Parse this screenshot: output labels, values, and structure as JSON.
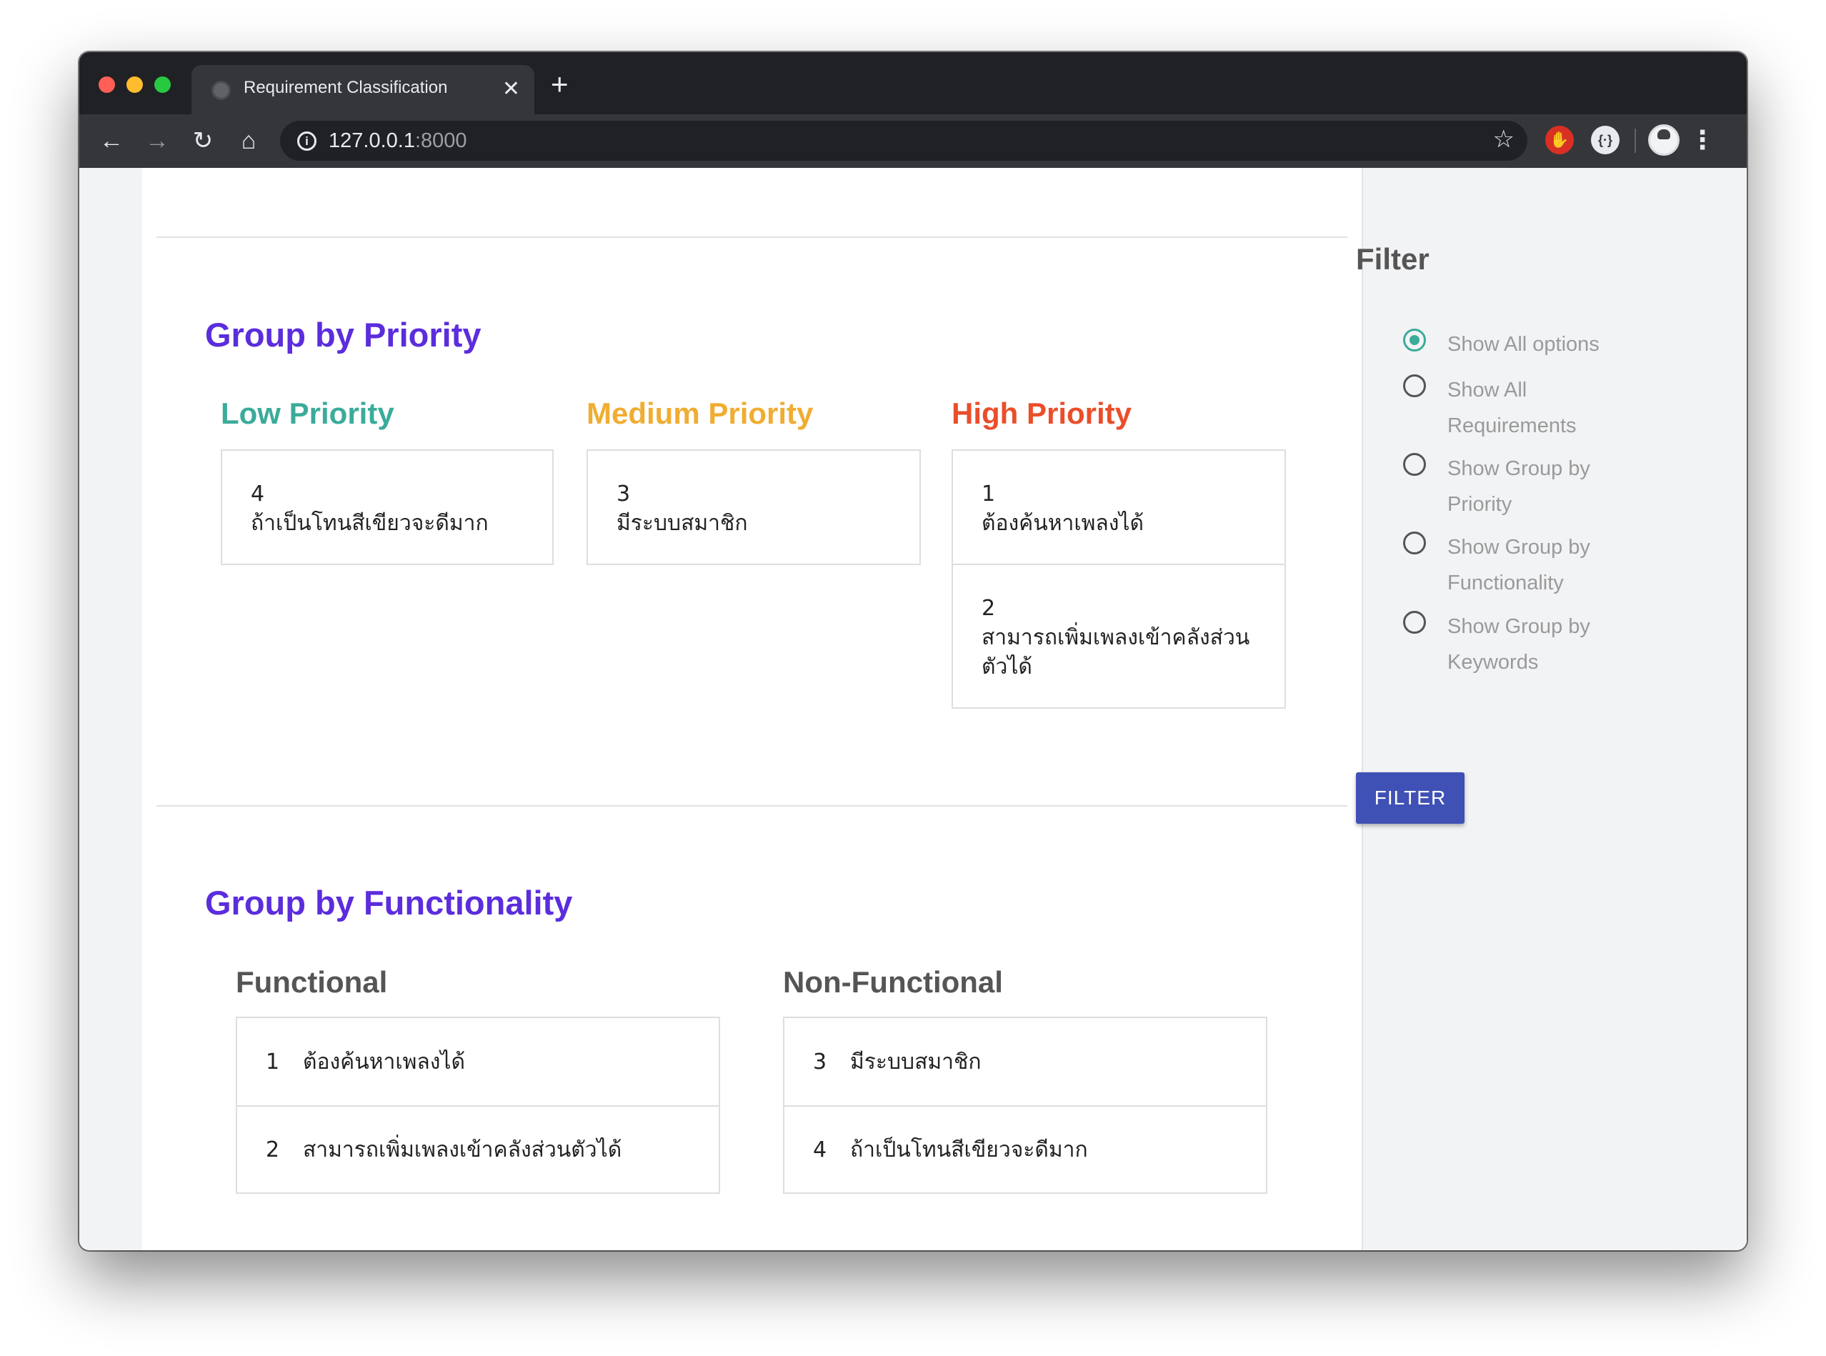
{
  "browser": {
    "tab_title": "Requirement Classification",
    "tab_close": "✕",
    "new_tab": "+",
    "url_host": "127.0.0.1",
    "url_port": ":8000"
  },
  "priority_section": {
    "title": "Group by Priority",
    "columns": [
      {
        "title": "Low Priority",
        "color": "#3bab9a",
        "items": [
          {
            "num": "4",
            "text": "ถ้าเป็นโทนสีเขียวจะดีมาก"
          }
        ]
      },
      {
        "title": "Medium Priority",
        "color": "#f0ad32",
        "items": [
          {
            "num": "3",
            "text": "มีระบบสมาชิก"
          }
        ]
      },
      {
        "title": "High Priority",
        "color": "#ea4e2a",
        "items": [
          {
            "num": "1",
            "text": "ต้องค้นหาเพลงได้"
          },
          {
            "num": "2",
            "text": "สามารถเพิ่มเพลงเข้าคลังส่วนตัวได้"
          }
        ]
      }
    ]
  },
  "functionality_section": {
    "title": "Group by Functionality",
    "columns": [
      {
        "title": "Functional",
        "items": [
          {
            "num": "1",
            "text": "ต้องค้นหาเพลงได้"
          },
          {
            "num": "2",
            "text": "สามารถเพิ่มเพลงเข้าคลังส่วนตัวได้"
          }
        ]
      },
      {
        "title": "Non-Functional",
        "items": [
          {
            "num": "3",
            "text": "มีระบบสมาชิก"
          },
          {
            "num": "4",
            "text": "ถ้าเป็นโทนสีเขียวจะดีมาก"
          }
        ]
      }
    ]
  },
  "filter": {
    "title": "Filter",
    "options": [
      {
        "label": "Show All options",
        "checked": true
      },
      {
        "label": "Show All Requirements",
        "checked": false
      },
      {
        "label": "Show Group by Priority",
        "checked": false
      },
      {
        "label": "Show Group by Functionality",
        "checked": false
      },
      {
        "label": "Show Group by Keywords",
        "checked": false
      }
    ],
    "button_label": "FILTER"
  },
  "colors": {
    "section_title": "#5b2ddd",
    "accent_radio": "#3bab9a",
    "filter_button": "#3f51b5"
  }
}
